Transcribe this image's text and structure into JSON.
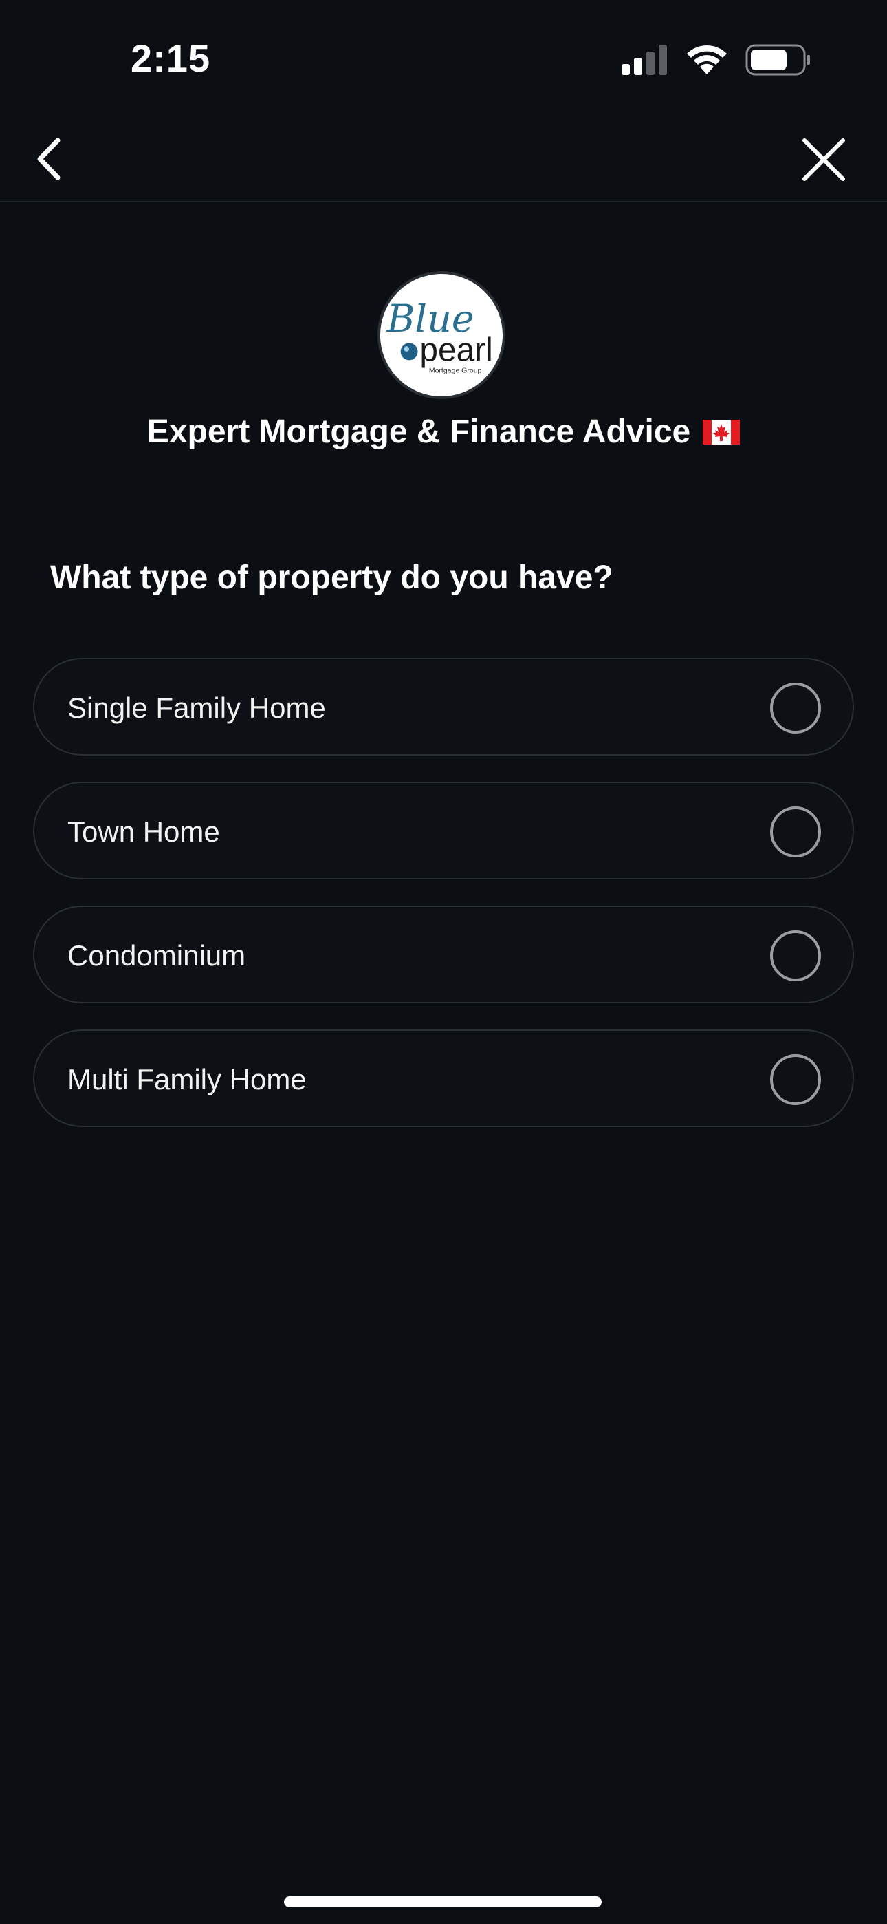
{
  "status_bar": {
    "time": "2:15",
    "icons": [
      "signal-icon",
      "wifi-icon",
      "battery-icon"
    ]
  },
  "nav": {
    "back_icon": "chevron-left-icon",
    "close_icon": "close-icon"
  },
  "brand": {
    "logo_script_text": "Blue",
    "logo_main_text": "pearl",
    "logo_sub_text": "Mortgage Group",
    "title": "Expert Mortgage & Finance Advice",
    "flag_icon": "canada-flag-icon"
  },
  "question": {
    "text": "What type of property do you have?"
  },
  "options": [
    {
      "label": "Single Family Home",
      "selected": false
    },
    {
      "label": "Town Home",
      "selected": false
    },
    {
      "label": "Condominium",
      "selected": false
    },
    {
      "label": "Multi Family Home",
      "selected": false
    }
  ],
  "colors": {
    "background": "#0b0f13",
    "option_border": "#2a2f36",
    "radio_border": "#9a9ea3",
    "text": "#ffffff",
    "logo_blue": "#2a6f8f"
  }
}
